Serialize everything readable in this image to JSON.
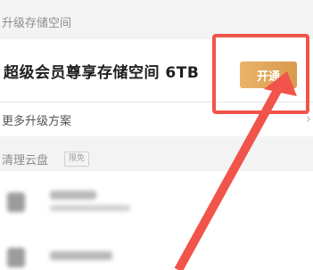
{
  "upgrade_section": {
    "header": "升级存储空间",
    "plan_title": "超级会员尊享存储空间 6TB",
    "open_button": "开通",
    "more_plans": "更多升级方案"
  },
  "clean_section": {
    "header": "清理云盘",
    "tag": "限免"
  },
  "colors": {
    "highlight": "#f1544a",
    "button": "#d89a4d"
  },
  "icons": [
    "chevron-right-icon",
    "arrow-annotation"
  ]
}
